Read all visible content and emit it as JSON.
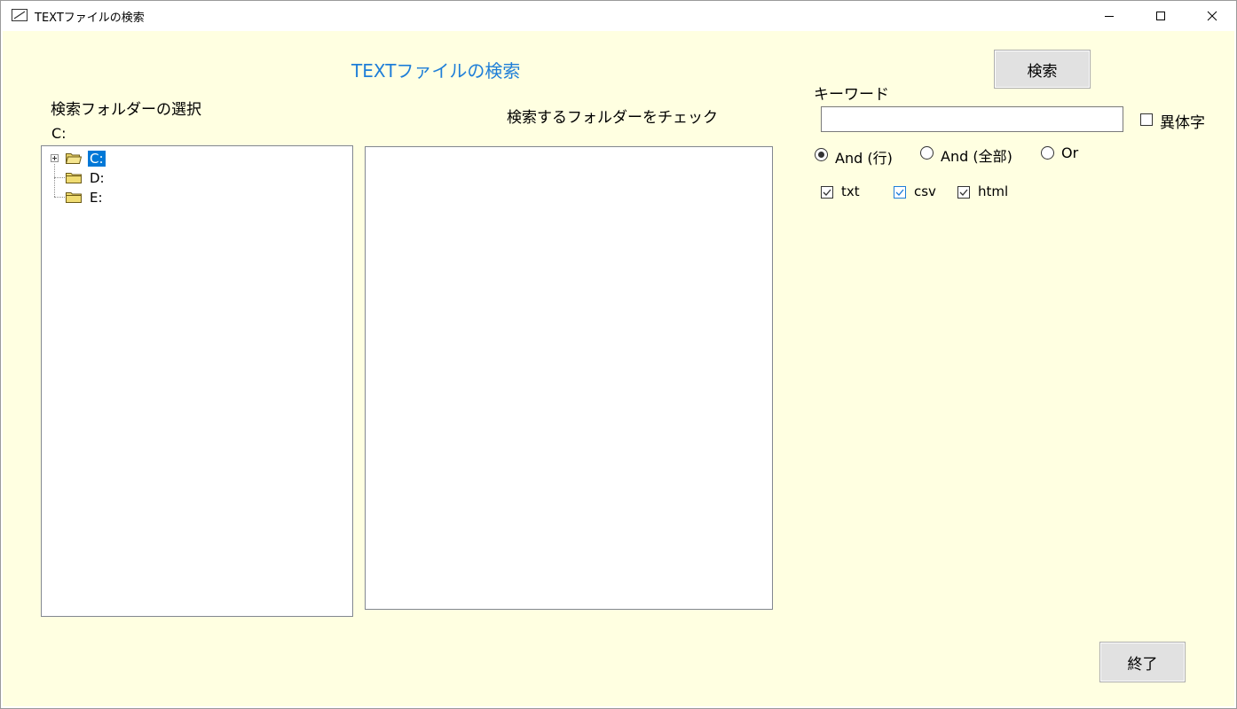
{
  "window": {
    "title": "TEXTファイルの検索",
    "minimize_glyph": "—",
    "maximize_glyph": "☐",
    "close_glyph": "✕"
  },
  "main": {
    "heading": "TEXTファイルの検索",
    "folder_select_label": "検索フォルダーの選択",
    "current_path": "C:",
    "check_folder_label": "検索するフォルダーをチェック",
    "tree": [
      {
        "label": "C:",
        "selected": true,
        "expandable": true
      },
      {
        "label": "D:",
        "selected": false,
        "expandable": false
      },
      {
        "label": "E:",
        "selected": false,
        "expandable": false
      }
    ]
  },
  "search": {
    "button_label": "検索",
    "keyword_label": "キーワード",
    "keyword_value": "",
    "variant_label": "異体字",
    "variant_checked": false,
    "modes": [
      {
        "label": "And (行)",
        "selected": true
      },
      {
        "label": "And (全部)",
        "selected": false
      },
      {
        "label": "Or",
        "selected": false
      }
    ],
    "extensions": [
      {
        "label": "txt",
        "checked": true
      },
      {
        "label": "csv",
        "checked": true
      },
      {
        "label": "html",
        "checked": true
      }
    ]
  },
  "footer": {
    "exit_label": "終了"
  },
  "colors": {
    "client_bg": "#ffffe1",
    "heading": "#1e7ed8",
    "selection": "#0078d7"
  }
}
